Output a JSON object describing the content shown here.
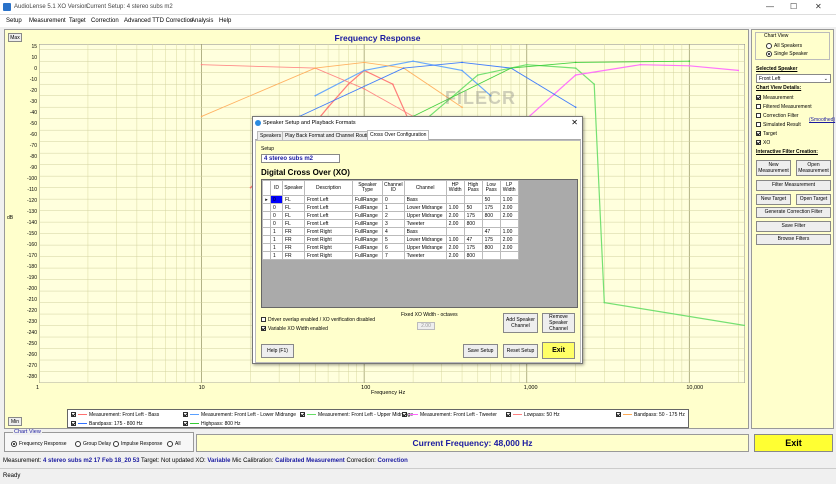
{
  "titlebar": {
    "app": "AudioLense 5.1 XO Version",
    "document": "Current Setup: 4 stereo subs m2",
    "min": "—",
    "max": "☐",
    "close": "✕"
  },
  "menu": [
    "Setup",
    "Measurement",
    "Target",
    "Correction",
    "Advanced TTD Correction",
    "Analysis",
    "Help"
  ],
  "chart": {
    "max_btn": "Max",
    "min_btn": "Min",
    "title": "Frequency Response",
    "ylabel": "dB",
    "xlabel": "Frequency Hz",
    "yticks": [
      "15",
      "10",
      "0",
      "-10",
      "-20",
      "-30",
      "-40",
      "-50",
      "-60",
      "-70",
      "-80",
      "-90",
      "-100",
      "-110",
      "-120",
      "-130",
      "-140",
      "-150",
      "-160",
      "-170",
      "-180",
      "-190",
      "-200",
      "-210",
      "-220",
      "-230",
      "-240",
      "-250",
      "-260",
      "-270",
      "-280"
    ],
    "xticks": [
      "1",
      "10",
      "100",
      "1,000",
      "10,000"
    ],
    "watermark": "FILECR"
  },
  "chart_data": {
    "type": "line",
    "title": "Frequency Response",
    "xlabel": "Frequency Hz",
    "ylabel": "dB",
    "xscale": "log",
    "xlim": [
      1,
      22000
    ],
    "ylim": [
      -280,
      15
    ],
    "grid": true,
    "series": [
      {
        "name": "Measurement: Front Left - Bass",
        "color": "#ff7070",
        "x": [
          20,
          40,
          60,
          80,
          100,
          150,
          200
        ],
        "y": [
          -110,
          -70,
          -40,
          -20,
          -8,
          -20,
          -60
        ]
      },
      {
        "name": "Measurement: Front Left - Lower Midrange",
        "color": "#5aa0ff",
        "x": [
          50,
          100,
          200,
          400,
          600
        ],
        "y": [
          -30,
          -8,
          0,
          -8,
          -30
        ]
      },
      {
        "name": "Measurement: Front Left - Upper Midrange",
        "color": "#66dd66",
        "x": [
          200,
          500,
          1000,
          2000,
          2600,
          3000,
          22000
        ],
        "y": [
          -60,
          -12,
          -3,
          -6,
          -20,
          -210,
          -230
        ]
      },
      {
        "name": "Measurement: Front Left - Tweeter",
        "color": "#ff66ff",
        "x": [
          1000,
          2000,
          5000,
          10000,
          20000
        ],
        "y": [
          -50,
          -12,
          -3,
          -4,
          -8
        ]
      },
      {
        "name": "Lowpass: 50 Hz",
        "color": "#ff8080",
        "x": [
          10,
          50,
          100,
          200
        ],
        "y": [
          -3,
          -6,
          -24,
          -48
        ]
      },
      {
        "name": "Bandpass: 50 - 175 Hz",
        "color": "#ffaa55",
        "x": [
          10,
          50,
          100,
          175,
          400
        ],
        "y": [
          -48,
          -6,
          -1,
          -6,
          -40
        ]
      },
      {
        "name": "Bandpass: 175 - 800 Hz",
        "color": "#3070ff",
        "x": [
          40,
          175,
          400,
          800,
          2000
        ],
        "y": [
          -48,
          -6,
          -1,
          -6,
          -40
        ]
      },
      {
        "name": "Highpass: 800 Hz",
        "color": "#33cc33",
        "x": [
          200,
          800,
          2000,
          10000
        ],
        "y": [
          -48,
          -6,
          -1,
          0
        ]
      }
    ]
  },
  "legend": [
    {
      "label": "Measurement: Front Left - Bass",
      "color": "#ff7070"
    },
    {
      "label": "Measurement: Front Left - Lower Midrange",
      "color": "#5aa0ff"
    },
    {
      "label": "Measurement: Front Left - Upper Midrange",
      "color": "#66dd66"
    },
    {
      "label": "Measurement: Front Left - Tweeter",
      "color": "#ff66ff"
    },
    {
      "label": "Lowpass: 50 Hz",
      "color": "#ff8080"
    },
    {
      "label": "Bandpass: 50 - 175 Hz",
      "color": "#ffaa55"
    },
    {
      "label": "Bandpass: 175 - 800 Hz",
      "color": "#3070ff"
    },
    {
      "label": "Highpass: 800 Hz",
      "color": "#33cc33"
    }
  ],
  "right": {
    "chart_view_h": "Chart View",
    "all_speakers": "All Speakers",
    "single_speaker": "Single Speaker",
    "selected_speaker_h": "Selected Speaker",
    "selected_speaker": "Front Left",
    "details_h": "Chart View Details:",
    "details": [
      {
        "label": "Measurement",
        "checked": true
      },
      {
        "label": "Filtered Measurement",
        "checked": false
      },
      {
        "label": "Correction Filter",
        "checked": false
      },
      {
        "label": "Simulated Result",
        "checked": false
      },
      {
        "label": "Target",
        "checked": true
      },
      {
        "label": "XO",
        "checked": true
      }
    ],
    "smoothed": "(Smoothed)",
    "interactive_h": "Interactive Filter Creation:",
    "new_measurement": "New\nMeasurement",
    "open_measurement": "Open\nMeasurement",
    "filter_measurement": "Filter Measurement",
    "new_target": "New Target",
    "open_target": "Open Target",
    "generate": "Generate Correction Filter",
    "save_filter": "Save Filter",
    "browse_filters": "Browse Filters"
  },
  "bottom": {
    "chart_view": "Chart View",
    "options": [
      "Frequency Response",
      "Group Delay",
      "Impulse Response",
      "All"
    ],
    "current_frequency": "Current Frequency: 48,000 Hz",
    "exit": "Exit",
    "status": {
      "measurement_l": "Measurement:",
      "measurement_v": "4 stereo subs m2 17 Feb 18_20 53",
      "target_l": "Target:",
      "target_v": "Not updated",
      "xo_l": "XO:",
      "xo_v": "Variable",
      "mic_l": "Mic Calibration:",
      "mic_v": "Calibrated Measurement",
      "corr_l": "Correction:",
      "corr_v": "Correction"
    },
    "ready": "Ready"
  },
  "dialog": {
    "title": "Speaker Setup and Playback Formats",
    "close": "✕",
    "tabs": [
      "Speakers",
      "Play Back Format and Channel Routing",
      "Cross Over Configuration"
    ],
    "setup_label": "Setup",
    "setup_value": "4 stereo subs m2",
    "xo_title": "Digital Cross Over (XO)",
    "columns": [
      "ID",
      "Speaker",
      "Description",
      "Speaker\nType",
      "Channel\nID",
      "Channel",
      "HP\nWidth",
      "High\nPass",
      "Low\nPass",
      "LP\nWidth"
    ],
    "rows": [
      [
        "0",
        "FL",
        "Front Left",
        "FullRange",
        "0",
        "Bass",
        "",
        "",
        "50",
        "1.00"
      ],
      [
        "0",
        "FL",
        "Front Left",
        "FullRange",
        "1",
        "Lower Midrange",
        "1.00",
        "50",
        "175",
        "2.00"
      ],
      [
        "0",
        "FL",
        "Front Left",
        "FullRange",
        "2",
        "Upper Midrange",
        "2.00",
        "175",
        "800",
        "2.00"
      ],
      [
        "0",
        "FL",
        "Front Left",
        "FullRange",
        "3",
        "Tweeter",
        "2.00",
        "800",
        "",
        ""
      ],
      [
        "1",
        "FR",
        "Front Right",
        "FullRange",
        "4",
        "Bass",
        "",
        "",
        "47",
        "1.00"
      ],
      [
        "1",
        "FR",
        "Front Right",
        "FullRange",
        "5",
        "Lower Midrange",
        "1.00",
        "47",
        "175",
        "2.00"
      ],
      [
        "1",
        "FR",
        "Front Right",
        "FullRange",
        "6",
        "Upper Midrange",
        "2.00",
        "175",
        "800",
        "2.00"
      ],
      [
        "1",
        "FR",
        "Front Right",
        "FullRange",
        "7",
        "Tweeter",
        "2.00",
        "800",
        "",
        ""
      ]
    ],
    "driver_overlap": "Driver overlap enabled / XO verification disabled",
    "variable_xo": "Variable XO Width enabled",
    "fixed_xo_label": "Fixed XO Width - octaves",
    "fixed_xo_value": "2.00",
    "add_channel": "Add Speaker\nChannel",
    "remove_channel": "Remove\nSpeaker\nChannel",
    "help": "Help (F1)",
    "save_setup": "Save Setup",
    "reset_setup": "Reset Setup",
    "exit": "Exit"
  }
}
